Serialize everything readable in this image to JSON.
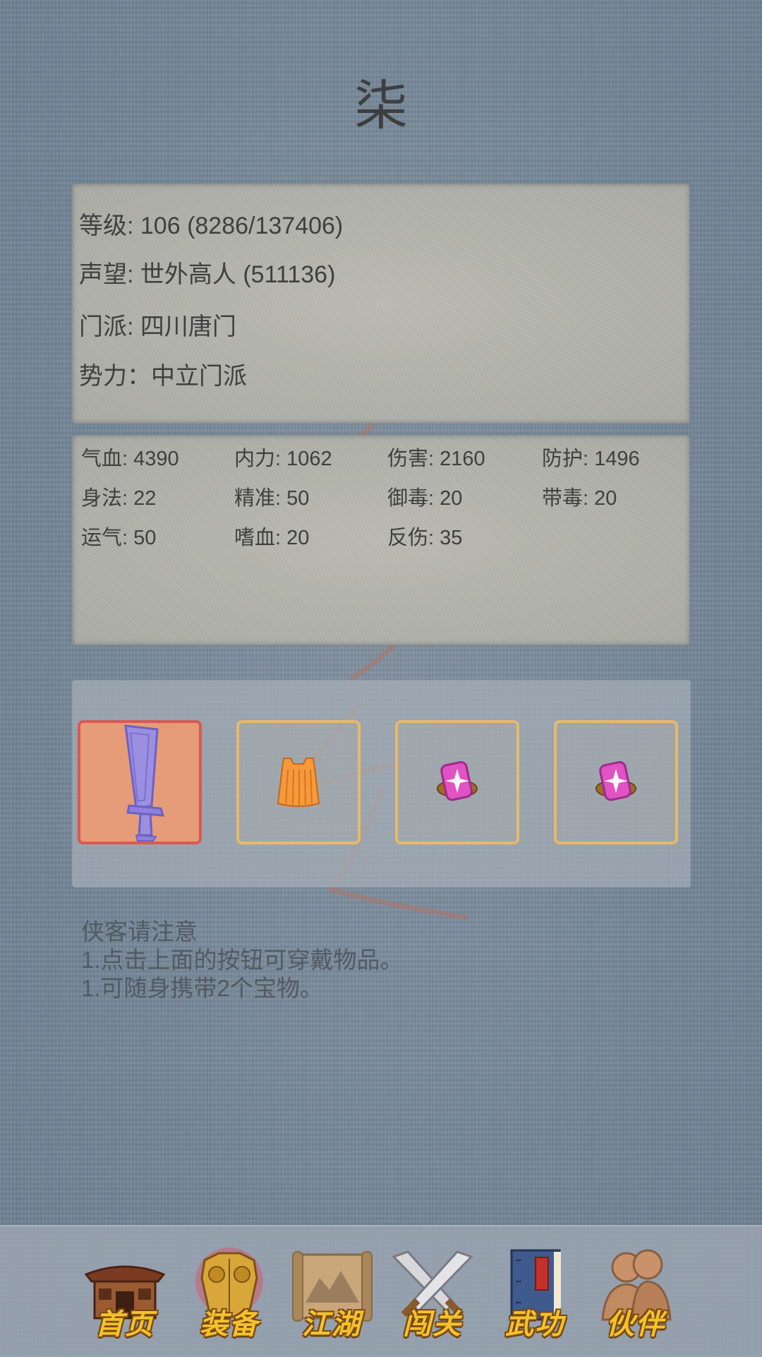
{
  "character": {
    "name": "柒"
  },
  "info": {
    "level": "等级: 106 (8286/137406)",
    "reputation": "声望: 世外高人 (511136)",
    "sect": "门派: 四川唐门",
    "faction": "势力：中立门派"
  },
  "stats": [
    "气血: 4390",
    "内力: 1062",
    "伤害: 2160",
    "防护: 1496",
    "身法: 22",
    "精准: 50",
    "御毒: 20",
    "带毒: 20",
    "运气: 50",
    "嗜血: 20",
    "反伤: 35"
  ],
  "equipment": [
    {
      "icon": "broadsword-icon",
      "selected": true
    },
    {
      "icon": "orange-robe-icon",
      "selected": false
    },
    {
      "icon": "pink-treasure-icon",
      "selected": false
    },
    {
      "icon": "pink-treasure-icon",
      "selected": false
    }
  ],
  "notice": {
    "title": "侠客请注意",
    "line1": "1.点击上面的按钮可穿戴物品。",
    "line2": "1.可随身携带2个宝物。"
  },
  "nav": [
    {
      "label": "首页",
      "icon": "house-icon"
    },
    {
      "label": "装备",
      "icon": "armor-icon",
      "active": true
    },
    {
      "label": "江湖",
      "icon": "scroll-map-icon"
    },
    {
      "label": "闯关",
      "icon": "crossed-swords-icon"
    },
    {
      "label": "武功",
      "icon": "martial-book-icon"
    },
    {
      "label": "伙伴",
      "icon": "companions-icon"
    }
  ],
  "colors": {
    "background": "#7a8b9b",
    "paper": "#b1b1aa",
    "slot_border": "#e8b86a",
    "selected_slot_bg": "#e69c79",
    "selected_slot_border": "#d95a52",
    "nav_text": "#f4c22a"
  }
}
